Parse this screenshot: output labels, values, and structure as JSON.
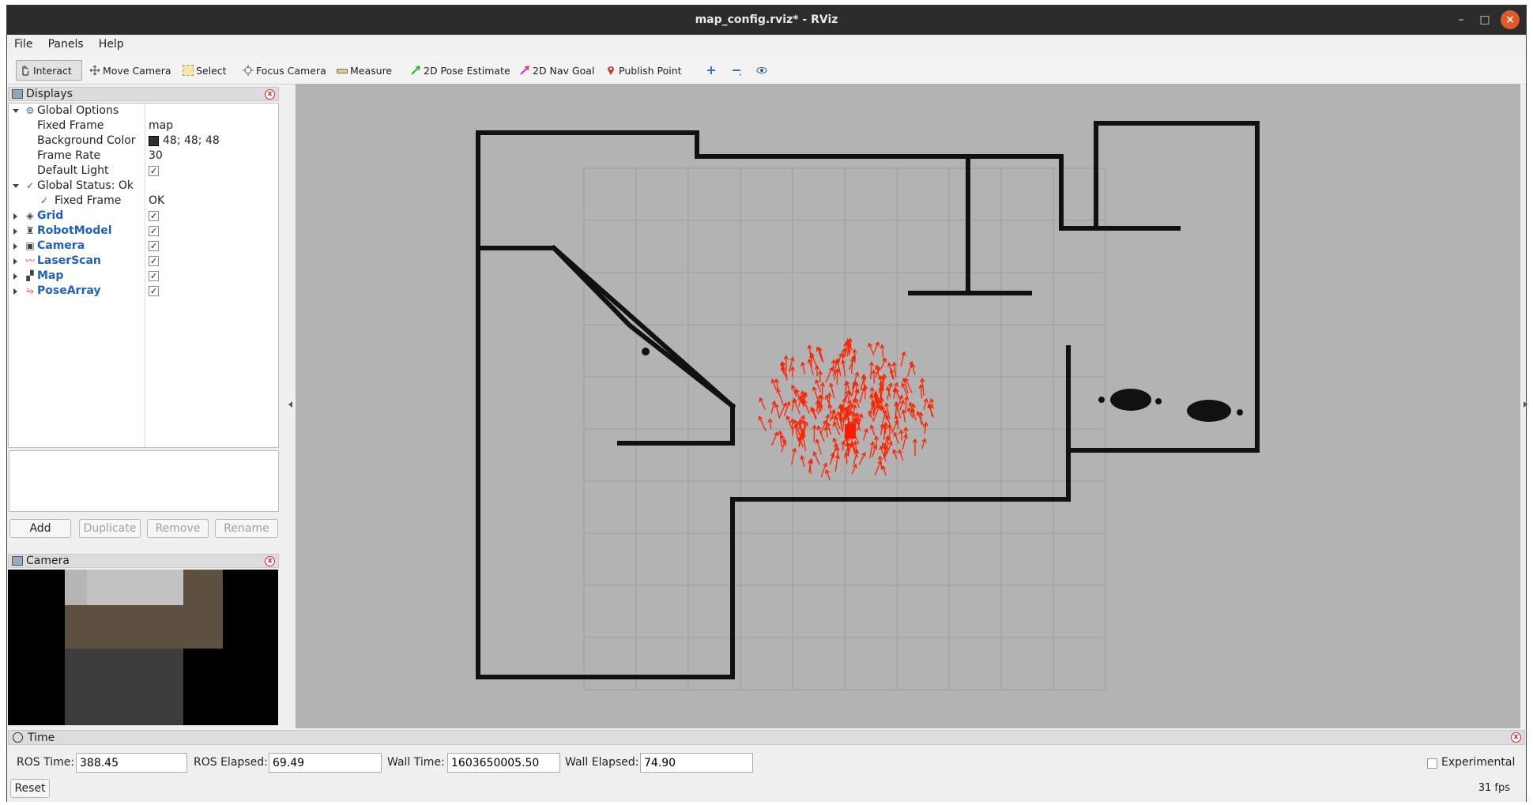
{
  "window": {
    "title": "map_config.rviz* - RViz"
  },
  "menu": [
    "File",
    "Panels",
    "Help"
  ],
  "toolbar": {
    "interact": "Interact",
    "move_camera": "Move Camera",
    "select": "Select",
    "focus_camera": "Focus Camera",
    "measure": "Measure",
    "pose_estimate": "2D Pose Estimate",
    "nav_goal": "2D Nav Goal",
    "publish_point": "Publish Point"
  },
  "displays": {
    "title": "Displays",
    "global_options": "Global Options",
    "props": [
      {
        "label": "Fixed Frame",
        "value": "map"
      },
      {
        "label": "Background Color",
        "value": "48; 48; 48"
      },
      {
        "label": "Frame Rate",
        "value": "30"
      },
      {
        "label": "Default Light",
        "value": "✓"
      }
    ],
    "global_status": "Global Status: Ok",
    "fixed_frame_status": {
      "label": "Fixed Frame",
      "value": "OK"
    },
    "items": [
      {
        "label": "Grid",
        "checked": "✓"
      },
      {
        "label": "RobotModel",
        "checked": "✓"
      },
      {
        "label": "Camera",
        "checked": "✓"
      },
      {
        "label": "LaserScan",
        "checked": "✓"
      },
      {
        "label": "Map",
        "checked": "✓"
      },
      {
        "label": "PoseArray",
        "checked": "✓"
      }
    ],
    "buttons": {
      "add": "Add",
      "duplicate": "Duplicate",
      "remove": "Remove",
      "rename": "Rename"
    }
  },
  "camera_panel": {
    "title": "Camera"
  },
  "time": {
    "title": "Time",
    "ros_time_label": "ROS Time:",
    "ros_time": "388.45",
    "ros_elapsed_label": "ROS Elapsed:",
    "ros_elapsed": "69.49",
    "wall_time_label": "Wall Time:",
    "wall_time": "1603650005.50",
    "wall_elapsed_label": "Wall Elapsed:",
    "wall_elapsed": "74.90",
    "experimental": "Experimental",
    "reset": "Reset",
    "fps": "31 fps"
  },
  "colors": {
    "background_swatch": "#303030",
    "particle": "#ff2200",
    "wall": "#111111",
    "floor": "#b3b3b3"
  }
}
